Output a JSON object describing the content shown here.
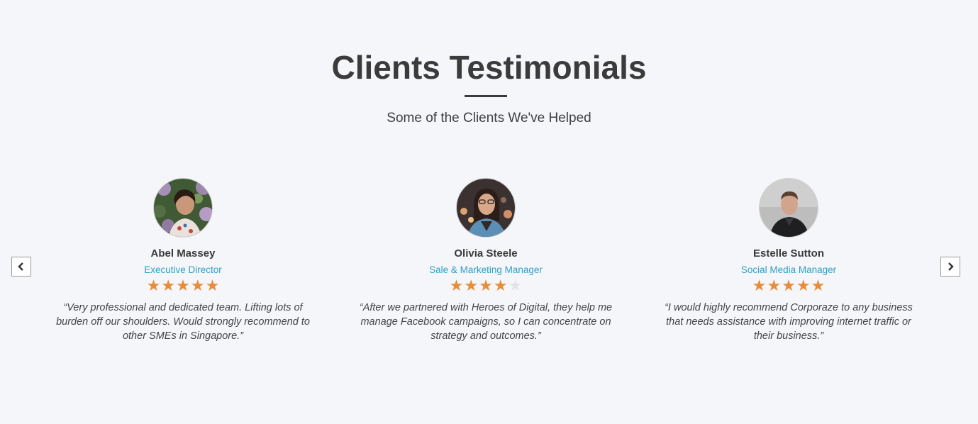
{
  "section": {
    "title": "Clients Testimonials",
    "subtitle": "Some of the Clients We've Helped"
  },
  "colors": {
    "background": "#f5f6fa",
    "role_text": "#2e9fc4",
    "star_filled": "#e88c3a",
    "star_empty": "#e3e3e6"
  },
  "carousel": {
    "prev_icon": "chevron-left-icon",
    "next_icon": "chevron-right-icon"
  },
  "testimonials": [
    {
      "name": "Abel Massey",
      "role": "Executive Director",
      "rating": 5,
      "max_rating": 5,
      "quote": "“Very professional and dedicated team. Lifting lots of burden off our shoulders. Would strongly recommend to other SMEs in Singapore.”"
    },
    {
      "name": "Olivia Steele",
      "role": "Sale & Marketing Manager",
      "rating": 4,
      "max_rating": 5,
      "quote": "“After we partnered with Heroes of Digital, they help me manage Facebook campaigns, so I can concentrate on strategy and outcomes.”"
    },
    {
      "name": "Estelle Sutton",
      "role": "Social Media Manager",
      "rating": 5,
      "max_rating": 5,
      "quote": "“I would highly recommend Corporaze to any business that needs assistance with improving internet traffic or their business.”"
    }
  ]
}
